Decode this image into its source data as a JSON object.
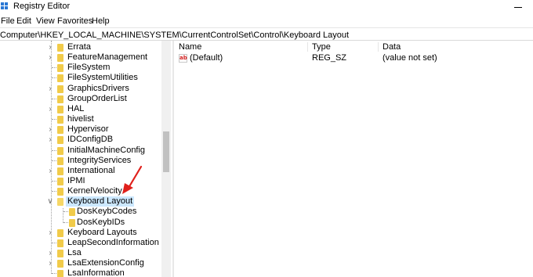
{
  "window": {
    "title": "Registry Editor",
    "icon": "registry-editor-icon"
  },
  "menu": [
    "File",
    "Edit",
    "View",
    "Favorites",
    "Help"
  ],
  "address": "Computer\\HKEY_LOCAL_MACHINE\\SYSTEM\\CurrentControlSet\\Control\\Keyboard Layout",
  "tree": {
    "items": [
      {
        "label": "Errata",
        "expander": "collapsed",
        "selected": false
      },
      {
        "label": "FeatureManagement",
        "expander": "collapsed",
        "selected": false
      },
      {
        "label": "FileSystem",
        "expander": "none",
        "selected": false
      },
      {
        "label": "FileSystemUtilities",
        "expander": "none",
        "selected": false
      },
      {
        "label": "GraphicsDrivers",
        "expander": "collapsed",
        "selected": false
      },
      {
        "label": "GroupOrderList",
        "expander": "none",
        "selected": false
      },
      {
        "label": "HAL",
        "expander": "collapsed",
        "selected": false
      },
      {
        "label": "hivelist",
        "expander": "none",
        "selected": false
      },
      {
        "label": "Hypervisor",
        "expander": "collapsed",
        "selected": false
      },
      {
        "label": "IDConfigDB",
        "expander": "collapsed",
        "selected": false
      },
      {
        "label": "InitialMachineConfig",
        "expander": "none",
        "selected": false
      },
      {
        "label": "IntegrityServices",
        "expander": "none",
        "selected": false
      },
      {
        "label": "International",
        "expander": "collapsed",
        "selected": false
      },
      {
        "label": "IPMI",
        "expander": "none",
        "selected": false
      },
      {
        "label": "KernelVelocity",
        "expander": "none",
        "selected": false
      },
      {
        "label": "Keyboard Layout",
        "expander": "expanded",
        "selected": true
      },
      {
        "label": "DosKeybCodes",
        "expander": "child",
        "selected": false
      },
      {
        "label": "DosKeybIDs",
        "expander": "child",
        "selected": false
      },
      {
        "label": "Keyboard Layouts",
        "expander": "collapsed",
        "selected": false
      },
      {
        "label": "LeapSecondInformation",
        "expander": "none",
        "selected": false
      },
      {
        "label": "Lsa",
        "expander": "collapsed",
        "selected": false
      },
      {
        "label": "LsaExtensionConfig",
        "expander": "collapsed",
        "selected": false
      },
      {
        "label": "LsaInformation",
        "expander": "none",
        "selected": false
      }
    ]
  },
  "list": {
    "columns": {
      "name": "Name",
      "type": "Type",
      "data": "Data"
    },
    "rows": [
      {
        "icon": "ab",
        "name": "(Default)",
        "type": "REG_SZ",
        "data": "(value not set)"
      }
    ]
  },
  "colors": {
    "selection": "#cce8ff",
    "folder": "#f1cb4a",
    "arrow": "#e0201b",
    "accent": "#2a78d4"
  }
}
